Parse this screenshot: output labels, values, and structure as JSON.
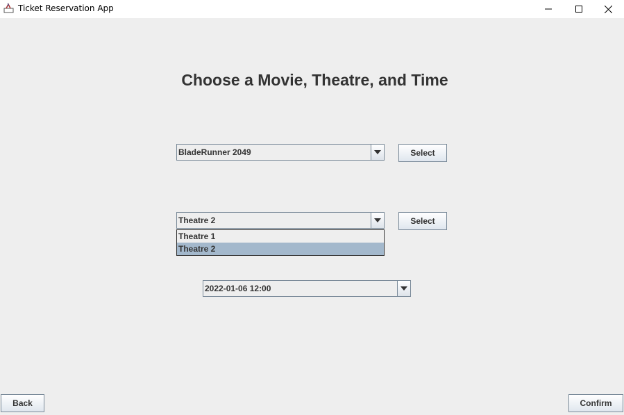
{
  "window": {
    "title": "Ticket Reservation App"
  },
  "heading": "Choose a Movie, Theatre, and Time",
  "movie": {
    "selected": "BladeRunner 2049",
    "select_label": "Select"
  },
  "theatre": {
    "selected": "Theatre 2",
    "select_label": "Select",
    "options": [
      "Theatre 1",
      "Theatre 2"
    ],
    "highlighted_option": "Theatre 2"
  },
  "showtime": {
    "selected": "2022-01-06 12:00"
  },
  "footer": {
    "back_label": "Back",
    "confirm_label": "Confirm"
  },
  "icons": {
    "app": "java-app-icon",
    "minimize": "minimize-icon",
    "maximize": "maximize-icon",
    "close": "close-icon",
    "dropdown": "triangle-down-icon"
  },
  "colors": {
    "background": "#eeeeee",
    "selection": "#a3b8cc",
    "border": "#7a8a99"
  }
}
